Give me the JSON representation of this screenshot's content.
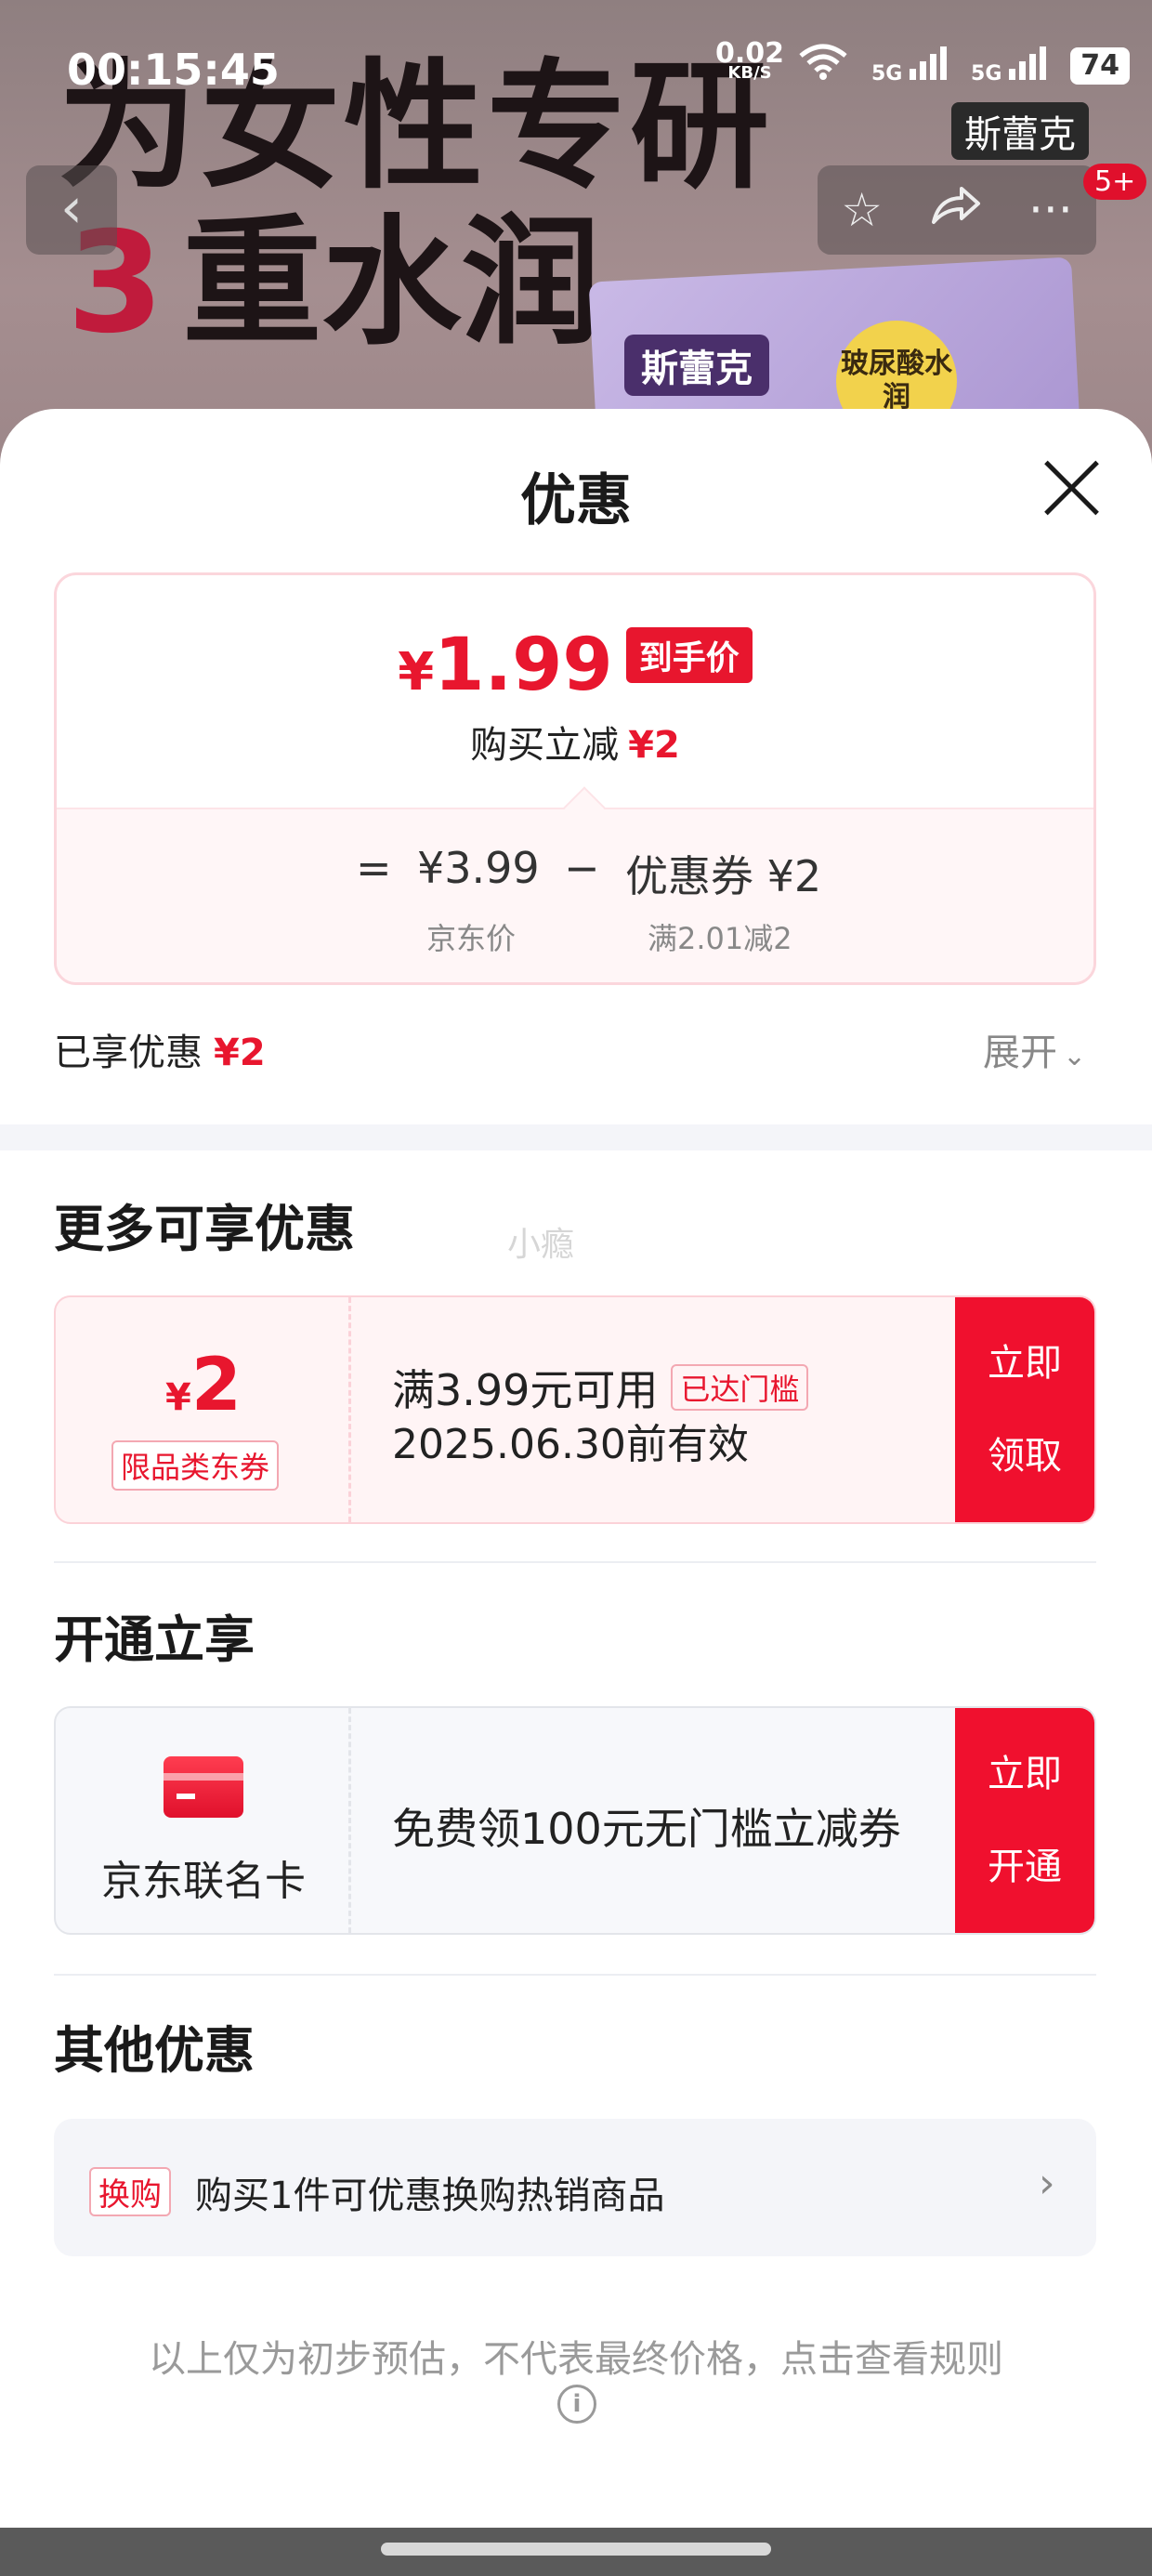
{
  "status_bar": {
    "time": "00:15:45",
    "net_speed": "0.02",
    "net_unit": "KB/S",
    "signal1": "5G",
    "signal2": "5G",
    "battery": "74"
  },
  "banner": {
    "headline_line1": "为女性专研",
    "headline_num": "3",
    "headline_line2": "重水润",
    "brand_logo": "斯蕾克",
    "box_brand": "斯蕾克",
    "box_badge": "玻尿酸水润",
    "notification_count": "5+"
  },
  "sheet": {
    "title": "优惠"
  },
  "price_card": {
    "currency": "¥",
    "final_price": "1.99",
    "final_price_tag": "到手价",
    "discount_label": "购买立减",
    "discount_amount": "¥2",
    "equals": "=",
    "jd_price": "¥3.99",
    "minus": "−",
    "coupon_label": "优惠券 ¥2",
    "jd_price_label": "京东价",
    "coupon_rule": "满2.01减2"
  },
  "enjoyed": {
    "label": "已享优惠",
    "amount": "¥2",
    "expand_label": "展开"
  },
  "more_offers": {
    "title": "更多可享优惠",
    "watermark": "小瘾",
    "coupon": {
      "currency": "¥",
      "amount": "2",
      "type": "限品类东券",
      "condition": "满3.99元可用",
      "condition_tag": "已达门槛",
      "validity": "2025.06.30前有效",
      "action_line1": "立即",
      "action_line2": "领取"
    }
  },
  "open_enjoy": {
    "title": "开通立享",
    "card_name": "京东联名卡",
    "offer": "免费领100元无门槛立减券",
    "action_line1": "立即",
    "action_line2": "开通"
  },
  "other_offers": {
    "title": "其他优惠",
    "tag": "换购",
    "text": "购买1件可优惠换购热销商品"
  },
  "disclaimer": "以上仅为初步预估，不代表最终价格，点击查看规则",
  "colors": {
    "accent_red": "#e8162e",
    "button_red": "#f0102e",
    "coupon_bg": "#fff4f5"
  }
}
